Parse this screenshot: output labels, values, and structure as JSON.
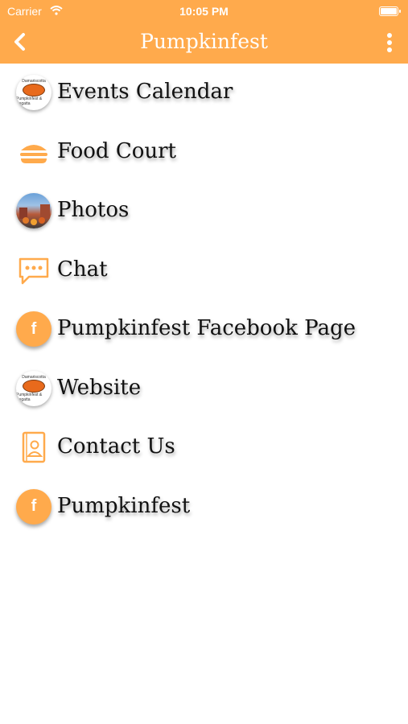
{
  "status_bar": {
    "carrier": "Carrier",
    "time": "10:05 PM"
  },
  "nav": {
    "title": "Pumpkinfest",
    "back_icon": "chevron-left-icon",
    "more_icon": "more-vertical-icon"
  },
  "colors": {
    "accent": "#FFAA4C",
    "text": "#111111"
  },
  "menu": {
    "items": [
      {
        "label": "Events Calendar",
        "icon": "pumpkinfest-logo-icon"
      },
      {
        "label": "Food Court",
        "icon": "burger-icon"
      },
      {
        "label": "Photos",
        "icon": "photo-thumbnail-icon"
      },
      {
        "label": "Chat",
        "icon": "chat-bubble-icon"
      },
      {
        "label": "Pumpkinfest Facebook Page",
        "icon": "facebook-icon"
      },
      {
        "label": "Website",
        "icon": "pumpkinfest-logo-icon"
      },
      {
        "label": "Contact Us",
        "icon": "contact-card-icon"
      },
      {
        "label": "Pumpkinfest",
        "icon": "facebook-icon"
      }
    ]
  },
  "logo_text": {
    "line1": "Damariscotta",
    "line2": "Pumpkinfest & Regatta"
  },
  "facebook_glyph": "f"
}
